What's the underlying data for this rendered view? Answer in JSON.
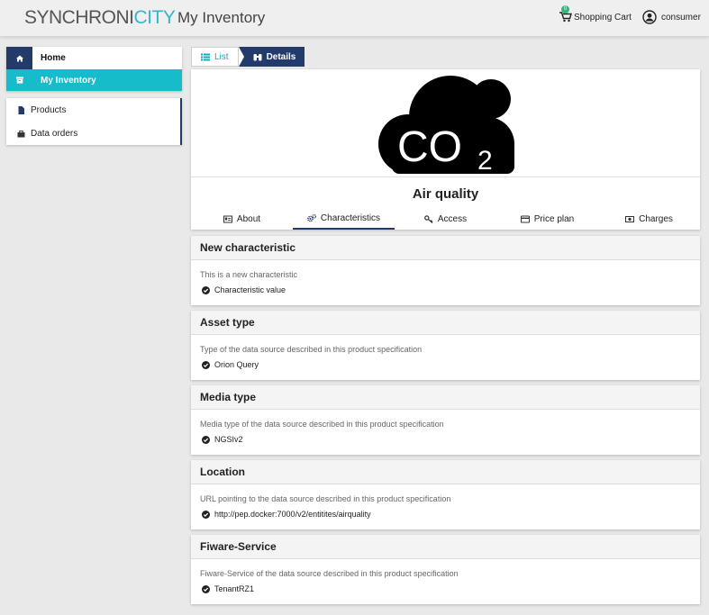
{
  "header": {
    "logo_main": "SYNCHRONI",
    "logo_accent": "CITY",
    "title": "My Inventory",
    "cart_label": "Shopping Cart",
    "cart_count": "0",
    "user_label": "consumer"
  },
  "sidebar": {
    "primary": [
      {
        "label": "Home",
        "icon": "home-icon"
      },
      {
        "label": "My Inventory",
        "icon": "archive-icon"
      }
    ],
    "secondary": [
      {
        "label": "Products",
        "icon": "file-icon"
      },
      {
        "label": "Data orders",
        "icon": "bag-icon"
      }
    ]
  },
  "view_tabs": {
    "list": "List",
    "details": "Details"
  },
  "product": {
    "name": "Air quality",
    "image_text": "CO",
    "image_sub": "2"
  },
  "detail_tabs": [
    {
      "label": "About",
      "icon": "id-card-icon"
    },
    {
      "label": "Characteristics",
      "icon": "cogs-icon",
      "active": true
    },
    {
      "label": "Access",
      "icon": "key-icon"
    },
    {
      "label": "Price plan",
      "icon": "credit-card-icon"
    },
    {
      "label": "Charges",
      "icon": "money-icon"
    }
  ],
  "characteristics": [
    {
      "title": "New characteristic",
      "description": "This is a new characteristic",
      "value": "Characteristic value"
    },
    {
      "title": "Asset type",
      "description": "Type of the data source described in this product specification",
      "value": "Orion Query"
    },
    {
      "title": "Media type",
      "description": "Media type of the data source described in this product specification",
      "value": "NGSIv2"
    },
    {
      "title": "Location",
      "description": "URL pointing to the data source described in this product specification",
      "value": "http://pep.docker:7000/v2/entitites/airquality"
    },
    {
      "title": "Fiware-Service",
      "description": "Fiware-Service of the data source described in this product specification",
      "value": "TenantRZ1"
    }
  ],
  "colors": {
    "navy": "#233b6b",
    "teal": "#16bcc9",
    "logo_accent": "#33b6cc",
    "badge": "#2db87d"
  }
}
